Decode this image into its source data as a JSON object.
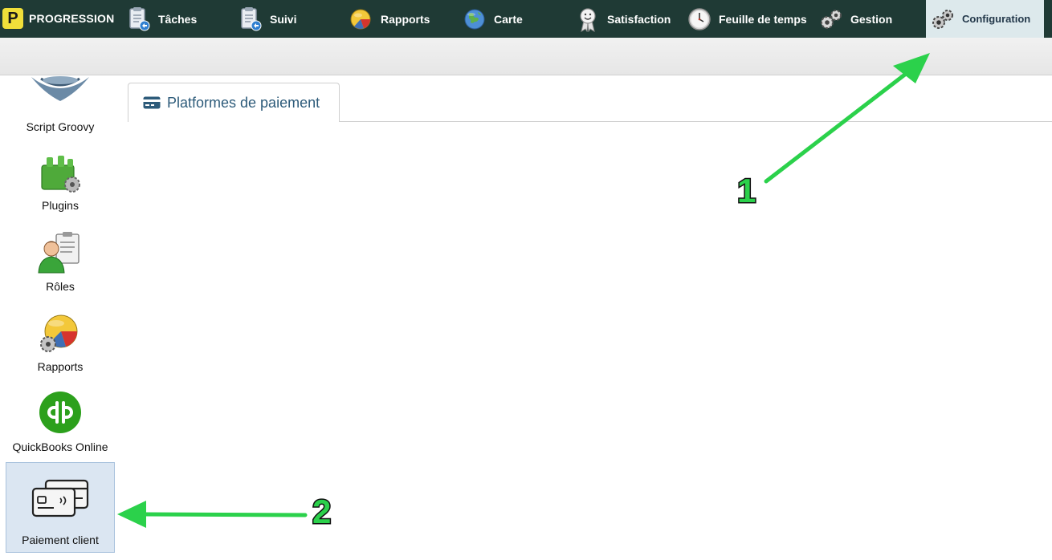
{
  "app": {
    "logo_letter": "P",
    "logo_text": "PROGRESSION"
  },
  "nav": {
    "items": [
      {
        "label": "Tâches",
        "icon": "clipboard-task-icon"
      },
      {
        "label": "Suivi",
        "icon": "clipboard-follow-icon"
      },
      {
        "label": "Rapports",
        "icon": "pie-chart-icon"
      },
      {
        "label": "Carte",
        "icon": "globe-icon"
      },
      {
        "label": "Satisfaction",
        "icon": "ribbon-award-icon"
      },
      {
        "label": "Feuille de temps",
        "icon": "clock-icon"
      },
      {
        "label": "Gestion",
        "icon": "gears-icon"
      },
      {
        "label": "Configuration",
        "icon": "gears-icon",
        "active": true
      }
    ]
  },
  "sidebar": {
    "items": [
      {
        "label": "Script Groovy",
        "icon": "groovy-logo-icon"
      },
      {
        "label": "Plugins",
        "icon": "plugin-puzzle-icon"
      },
      {
        "label": "Rôles",
        "icon": "user-role-icon"
      },
      {
        "label": "Rapports",
        "icon": "report-chart-gear-icon"
      },
      {
        "label": "QuickBooks Online",
        "icon": "quickbooks-logo-icon"
      },
      {
        "label": "Paiement client",
        "icon": "credit-cards-icon",
        "selected": true
      }
    ]
  },
  "tab": {
    "label": "Platformes de paiement",
    "icon": "credit-card-icon"
  },
  "annotations": {
    "arrow1_number": "1",
    "arrow2_number": "2"
  },
  "colors": {
    "topbar": "#1f3a35",
    "active_nav": "#dde9ec",
    "tab_text": "#2d5b7a",
    "arrow_green": "#2bd14b",
    "logo_yellow": "#f0df3a"
  }
}
